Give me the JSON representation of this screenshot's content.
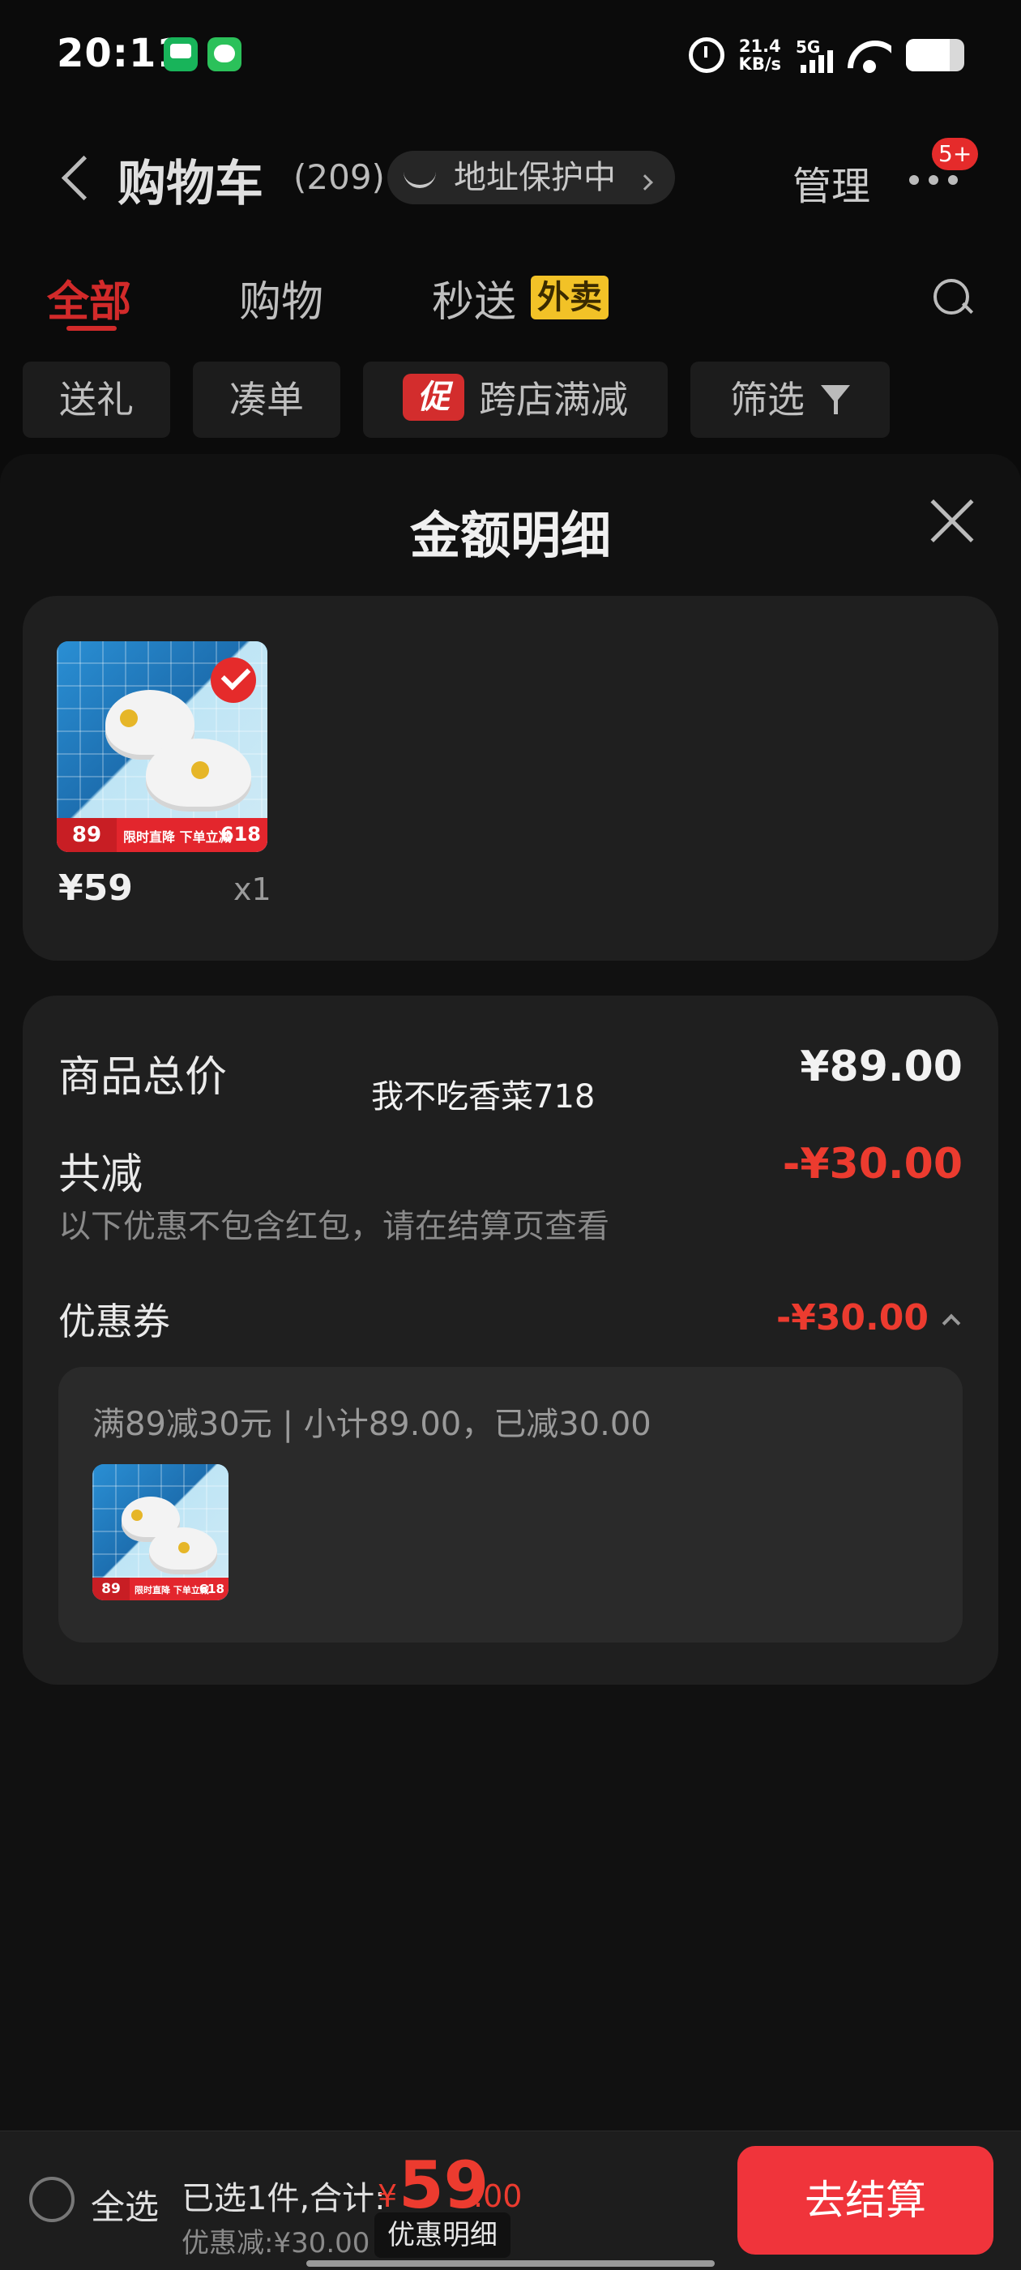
{
  "status_bar": {
    "time": "20:11",
    "net_speed_value": "21.4",
    "net_speed_unit": "KB/s",
    "network": "5G",
    "battery_level": 0.75
  },
  "header": {
    "title": "购物车",
    "count": "(209)",
    "address_protection": "地址保护中",
    "manage_label": "管理",
    "more_badge": "5+"
  },
  "tabs": [
    {
      "label": "全部",
      "active": true
    },
    {
      "label": "购物",
      "active": false
    },
    {
      "label": "秒送",
      "active": false,
      "badge": "外卖"
    }
  ],
  "filters": [
    {
      "label": "送礼"
    },
    {
      "label": "凑单"
    },
    {
      "label": "跨店满减",
      "tag": "促"
    },
    {
      "label": "筛选"
    }
  ],
  "sheet": {
    "title": "金额明细",
    "item": {
      "price": "¥59",
      "qty": "x1",
      "thumb_tag_left": "89",
      "thumb_tag_mid": "限时直降 下单立减",
      "thumb_tag_right": "618"
    },
    "total_label": "商品总价",
    "total_value": "¥89.00",
    "watermark": "我不吃香菜718",
    "discount_label": "共减",
    "discount_value": "-¥30.00",
    "discount_note": "以下优惠不包含红包，请在结算页查看",
    "coupon_label": "优惠券",
    "coupon_value": "-¥30.00",
    "coupon_desc": "满89减30元 | 小计89.00，已减30.00"
  },
  "bottom_bar": {
    "select_all": "全选",
    "summary": "已选1件,合计:",
    "currency": "¥",
    "total_int": "59",
    "total_dec": ".00",
    "discount_note": "优惠减:¥30.00",
    "detail_button": "优惠明细",
    "checkout_button": "去结算"
  },
  "colors": {
    "accent_red": "#ec3b2f",
    "checkout_red": "#f0343b",
    "badge_yellow": "#f2c227"
  }
}
